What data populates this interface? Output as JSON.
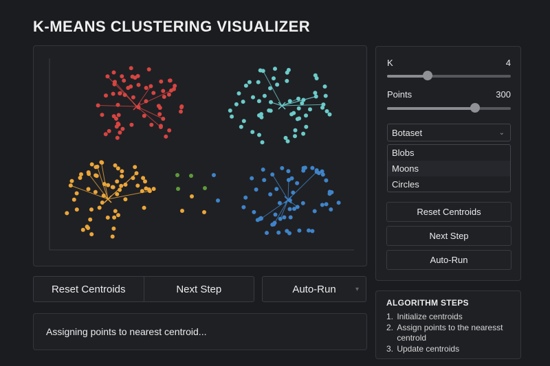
{
  "app_title": "K-MEANS CLUSTERING VISUALIZER",
  "colors": {
    "background": "#1b1c20",
    "cluster_red": "#d64541",
    "cluster_cyan": "#6ccbc9",
    "cluster_orange": "#eba63a",
    "cluster_blue": "#3f84c9",
    "unassigned_green": "#5e9a3a"
  },
  "canvas": {
    "clusters": [
      {
        "color": "red",
        "centroid_icon": "cross-icon"
      },
      {
        "color": "cyan",
        "centroid_icon": "cross-icon"
      },
      {
        "color": "orange",
        "centroid_icon": "cross-icon"
      },
      {
        "color": "blue",
        "centroid_icon": "cross-icon"
      }
    ]
  },
  "controls": {
    "k_label": "K",
    "k_value": "4",
    "k_fraction": 0.33,
    "points_label": "Points",
    "points_value": "300",
    "points_fraction": 0.71,
    "dataset_selected": "Botaset",
    "dataset_options": [
      "Blobs",
      "Moons",
      "Circles"
    ],
    "reset_label": "Reset Centroids",
    "next_label": "Next Step",
    "autorun_label": "Auto-Run"
  },
  "bottom_buttons": {
    "reset_label": "Reset Centroids",
    "next_label": "Next Step",
    "autorun_label": "Auto-Run"
  },
  "status_text": "Assigning points to nearest centroid...",
  "steps": {
    "heading": "ALGORITHM STEPS",
    "items": [
      {
        "num": "1.",
        "text": "Initialize centroids"
      },
      {
        "num": "2.",
        "text": "Assign points to the nearesst centrold"
      },
      {
        "num": "3.",
        "text": "Update centroids"
      }
    ]
  }
}
